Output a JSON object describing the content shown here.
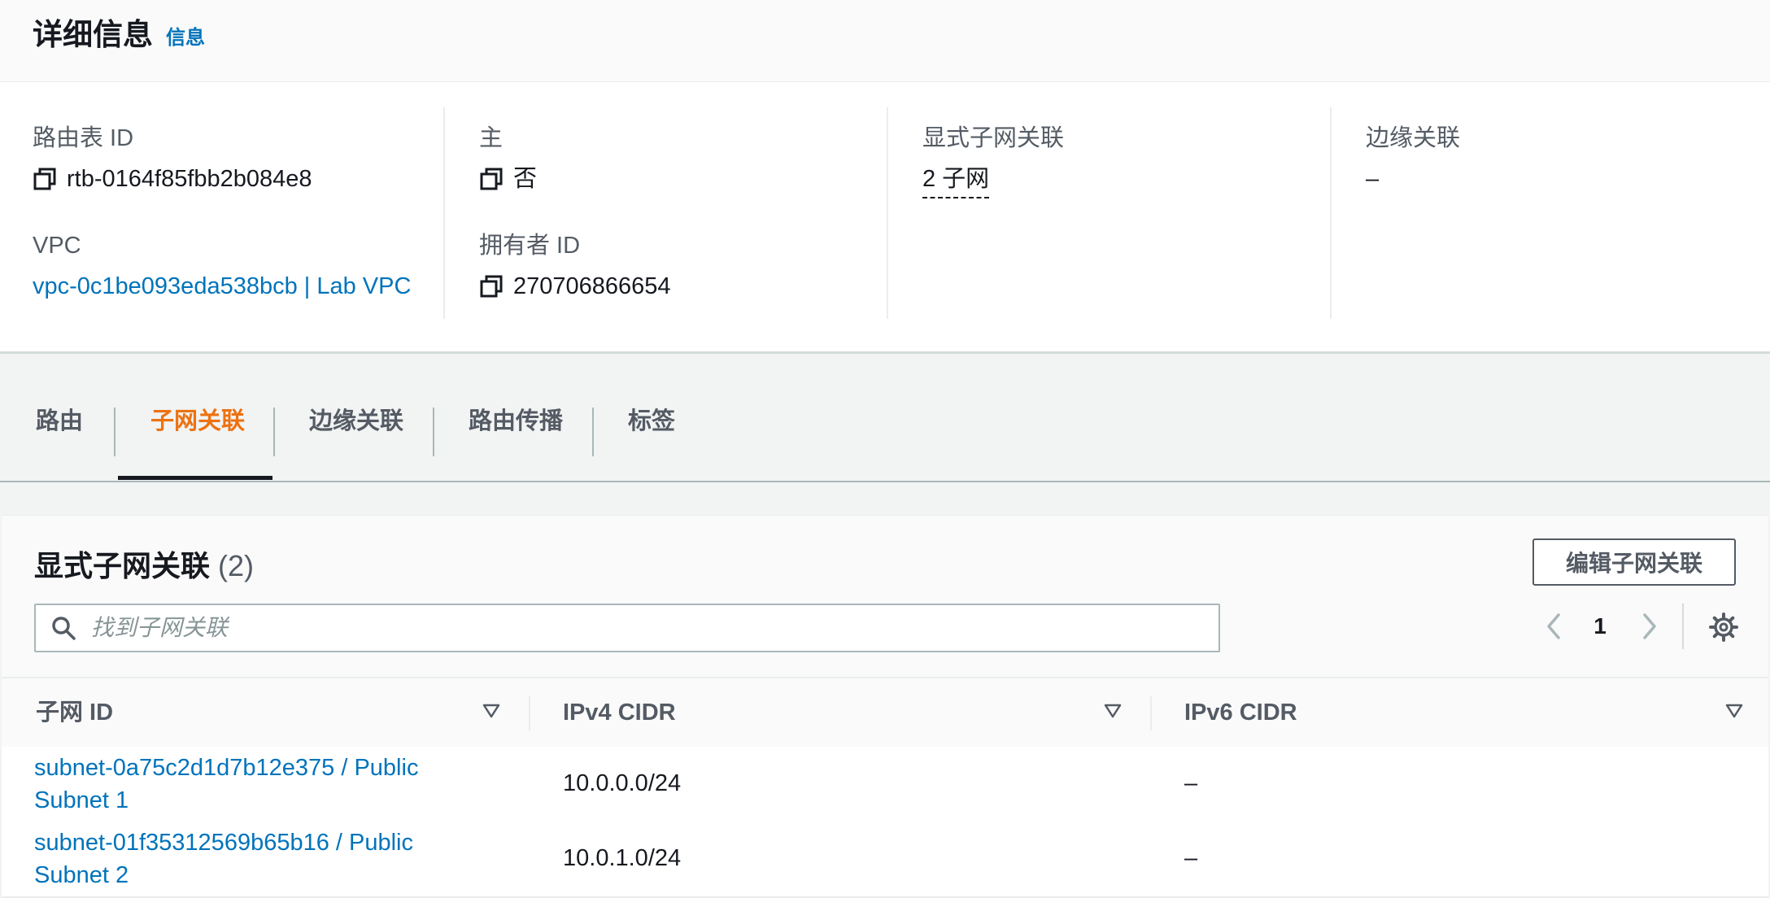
{
  "details": {
    "title": "详细信息",
    "info_link": "信息",
    "route_table_id": {
      "label": "路由表 ID",
      "value": "rtb-0164f85fbb2b084e8"
    },
    "vpc": {
      "label": "VPC",
      "value": "vpc-0c1be093eda538bcb | Lab VPC"
    },
    "main": {
      "label": "主",
      "value": "否"
    },
    "owner_id": {
      "label": "拥有者 ID",
      "value": "270706866654"
    },
    "explicit_subnet_associations": {
      "label": "显式子网关联",
      "value": "2 子网"
    },
    "edge_associations": {
      "label": "边缘关联",
      "value": "–"
    }
  },
  "tabs": [
    {
      "label": "路由",
      "active": false
    },
    {
      "label": "子网关联",
      "active": true
    },
    {
      "label": "边缘关联",
      "active": false
    },
    {
      "label": "路由传播",
      "active": false
    },
    {
      "label": "标签",
      "active": false
    }
  ],
  "subnet_panel": {
    "title": "显式子网关联",
    "count": "(2)",
    "edit_button": "编辑子网关联",
    "search_placeholder": "找到子网关联",
    "page": "1",
    "columns": [
      "子网 ID",
      "IPv4 CIDR",
      "IPv6 CIDR"
    ],
    "rows": [
      {
        "subnet": "subnet-0a75c2d1d7b12e375 / Public Subnet 1",
        "ipv4": "10.0.0.0/24",
        "ipv6": "–"
      },
      {
        "subnet": "subnet-01f35312569b65b16 / Public Subnet 2",
        "ipv4": "10.0.1.0/24",
        "ipv6": "–"
      }
    ]
  },
  "colors": {
    "link": "#0073bb",
    "active_tab": "#ec7211",
    "text": "#16191f",
    "muted": "#545b64",
    "background": "#f2f3f3"
  },
  "icons": [
    "copy-icon",
    "search-icon",
    "chevron-left-icon",
    "chevron-right-icon",
    "settings-icon",
    "sort-down-icon"
  ]
}
